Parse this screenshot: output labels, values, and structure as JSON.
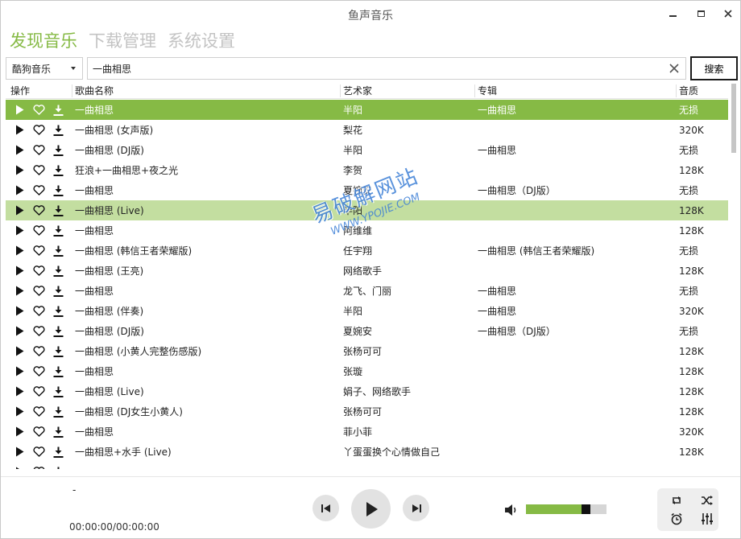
{
  "window": {
    "title": "鱼声音乐"
  },
  "tabs": [
    {
      "label": "发现音乐",
      "active": true
    },
    {
      "label": "下载管理",
      "active": false
    },
    {
      "label": "系统设置",
      "active": false
    }
  ],
  "search": {
    "source": "酷狗音乐",
    "query": "一曲相思",
    "button_label": "搜索"
  },
  "table": {
    "headers": {
      "actions": "操作",
      "name": "歌曲名称",
      "artist": "艺术家",
      "album": "专辑",
      "quality": "音质"
    },
    "rows": [
      {
        "name": "一曲相思",
        "artist": "半阳",
        "album": "一曲相思",
        "quality": "无损",
        "state": "selected"
      },
      {
        "name": "一曲相思 (女声版)",
        "artist": "梨花",
        "album": "",
        "quality": "320K",
        "state": ""
      },
      {
        "name": "一曲相思 (DJ版)",
        "artist": "半阳",
        "album": "一曲相思",
        "quality": "无损",
        "state": ""
      },
      {
        "name": "狂浪+一曲相思+夜之光",
        "artist": "李贺",
        "album": "",
        "quality": "128K",
        "state": ""
      },
      {
        "name": "一曲相思",
        "artist": "夏婉安",
        "album": "一曲相思（DJ版）",
        "quality": "无损",
        "state": ""
      },
      {
        "name": "一曲相思 (Live)",
        "artist": "半阳",
        "album": "",
        "quality": "128K",
        "state": "hover"
      },
      {
        "name": "一曲相思",
        "artist": "阿维维",
        "album": "",
        "quality": "128K",
        "state": ""
      },
      {
        "name": "一曲相思 (韩信王者荣耀版)",
        "artist": "任宇翔",
        "album": "一曲相思 (韩信王者荣耀版)",
        "quality": "无损",
        "state": ""
      },
      {
        "name": "一曲相思 (王亮)",
        "artist": "网络歌手",
        "album": "",
        "quality": "128K",
        "state": ""
      },
      {
        "name": "一曲相思",
        "artist": "龙飞、门丽",
        "album": "一曲相思",
        "quality": "无损",
        "state": ""
      },
      {
        "name": "一曲相思 (伴奏)",
        "artist": "半阳",
        "album": "一曲相思",
        "quality": "320K",
        "state": ""
      },
      {
        "name": "一曲相思 (DJ版)",
        "artist": "夏婉安",
        "album": "一曲相思（DJ版）",
        "quality": "无损",
        "state": ""
      },
      {
        "name": "一曲相思 (小黄人完整伤感版)",
        "artist": "张杨可可",
        "album": "",
        "quality": "128K",
        "state": ""
      },
      {
        "name": "一曲相思",
        "artist": "张璇",
        "album": "",
        "quality": "128K",
        "state": ""
      },
      {
        "name": "一曲相思 (Live)",
        "artist": "娟子、网络歌手",
        "album": "",
        "quality": "128K",
        "state": ""
      },
      {
        "name": "一曲相思 (DJ女生小黄人)",
        "artist": "张杨可可",
        "album": "",
        "quality": "128K",
        "state": ""
      },
      {
        "name": "一曲相思",
        "artist": "菲小菲",
        "album": "",
        "quality": "320K",
        "state": ""
      },
      {
        "name": "一曲相思+水手 (Live)",
        "artist": "丫蛋蛋换个心情做自己",
        "album": "",
        "quality": "128K",
        "state": ""
      },
      {
        "name": "",
        "artist": "",
        "album": "",
        "quality": "",
        "state": ""
      }
    ]
  },
  "watermark": {
    "line1": "易破解网站",
    "line2": "WWW.YPOJIE.COM"
  },
  "player": {
    "song_title": "-",
    "time": "00:00:00/00:00:00",
    "volume_level": 0.8
  },
  "colors": {
    "accent": "#86ba45",
    "row_hover": "#c3dea0",
    "tab_inactive": "#c3c3c3"
  },
  "icons": {
    "minimize": "minimize-icon",
    "maximize": "maximize-icon",
    "close": "close-icon",
    "play": "play-icon",
    "favorite": "heart-icon",
    "download": "download-icon",
    "clear": "clear-icon",
    "previous": "previous-icon",
    "next": "next-icon",
    "volume": "volume-icon",
    "repeat": "repeat-icon",
    "shuffle": "shuffle-icon",
    "timer": "alarm-clock-icon",
    "equalizer": "equalizer-icon"
  }
}
